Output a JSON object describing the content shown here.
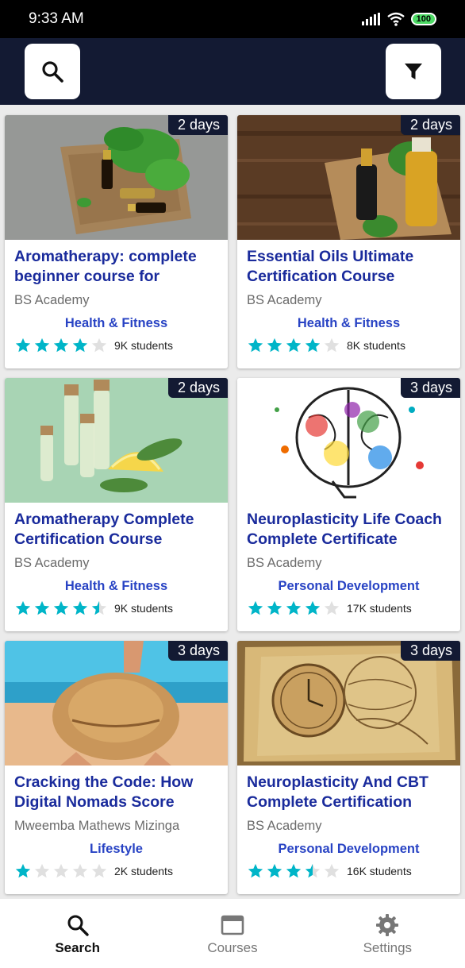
{
  "status_bar": {
    "time": "9:33 AM",
    "battery": "100"
  },
  "top_bar": {
    "search_icon": "search-icon",
    "filter_icon": "filter-icon"
  },
  "courses": [
    {
      "title": "Aromatherapy: complete beginner course for",
      "author": "BS Academy",
      "category": "Health & Fitness",
      "rating": 4,
      "students": "9K students",
      "badge": "2 days",
      "image": "essential-oil-bottles-with-mint"
    },
    {
      "title": "Essential Oils Ultimate Certification Course",
      "author": "BS Academy",
      "category": "Health & Fitness",
      "rating": 4,
      "students": "8K students",
      "badge": "2 days",
      "image": "oil-bottles-on-wood"
    },
    {
      "title": "Aromatherapy Complete Certification Course",
      "author": "BS Academy",
      "category": "Health & Fitness",
      "rating": 4.5,
      "students": "9K students",
      "badge": "2 days",
      "image": "oil-vials-with-lemon"
    },
    {
      "title": "Neuroplasticity Life Coach Complete Certificate",
      "author": "BS Academy",
      "category": "Personal Development",
      "rating": 4,
      "students": "17K students",
      "badge": "3 days",
      "image": "colorful-brain"
    },
    {
      "title": "Cracking the Code: How Digital Nomads Score",
      "author": "Mweemba Mathews Mizinga",
      "category": "Lifestyle",
      "rating": 1,
      "students": "2K students",
      "badge": "3 days",
      "image": "woman-with-sun-hat-on-beach"
    },
    {
      "title": "Neuroplasticity And CBT Complete Certification",
      "author": "BS Academy",
      "category": "Personal Development",
      "rating": 3.5,
      "students": "16K students",
      "badge": "3 days",
      "image": "vintage-clock-and-map"
    }
  ],
  "bottom_nav": [
    {
      "label": "Search",
      "icon": "search-icon",
      "active": true
    },
    {
      "label": "Courses",
      "icon": "window-icon",
      "active": false
    },
    {
      "label": "Settings",
      "icon": "gear-icon",
      "active": false
    }
  ],
  "colors": {
    "accent": "#131a33",
    "title": "#1a2b9c",
    "category": "#2843c4",
    "star": "#00b5c8"
  }
}
